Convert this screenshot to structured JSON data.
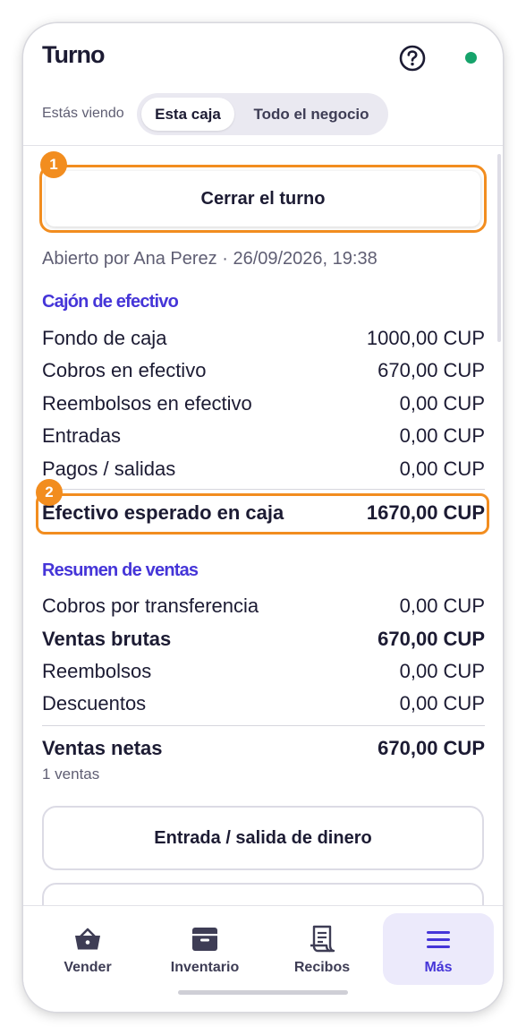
{
  "header": {
    "title": "Turno",
    "help_icon": "question-circle-icon",
    "status_color": "#16a36b"
  },
  "view_toggle": {
    "label": "Estás viendo",
    "options": [
      "Esta caja",
      "Todo el negocio"
    ],
    "selected": "Esta caja"
  },
  "callouts": [
    "1",
    "2"
  ],
  "close_shift_button": "Cerrar el turno",
  "opened_by": "Abierto por Ana Perez · 26/09/2026, 19:38",
  "cash_drawer": {
    "title": "Cajón de efectivo",
    "rows": [
      {
        "label": "Fondo de caja",
        "value": "1000,00 CUP"
      },
      {
        "label": "Cobros en efectivo",
        "value": "670,00 CUP"
      },
      {
        "label": "Reembolsos en efectivo",
        "value": "0,00 CUP"
      },
      {
        "label": "Entradas",
        "value": "0,00 CUP"
      },
      {
        "label": "Pagos / salidas",
        "value": "0,00 CUP"
      }
    ],
    "expected": {
      "label": "Efectivo esperado en caja",
      "value": "1670,00 CUP"
    }
  },
  "sales_summary": {
    "title": "Resumen de ventas",
    "rows": [
      {
        "label": "Cobros por transferencia",
        "value": "0,00 CUP"
      },
      {
        "label": "Ventas brutas",
        "value": "670,00 CUP"
      },
      {
        "label": "Reembolsos",
        "value": "0,00 CUP"
      },
      {
        "label": "Descuentos",
        "value": "0,00 CUP"
      }
    ],
    "net": {
      "label": "Ventas netas",
      "value": "670,00 CUP"
    },
    "count": "1 ventas"
  },
  "cash_in_out_button": "Entrada / salida de dinero",
  "bottom_nav": [
    {
      "label": "Vender",
      "icon": "basket-icon"
    },
    {
      "label": "Inventario",
      "icon": "archive-box-icon"
    },
    {
      "label": "Recibos",
      "icon": "receipt-icon"
    },
    {
      "label": "Más",
      "icon": "menu-icon",
      "active": true
    }
  ],
  "colors": {
    "accent": "#4535d8",
    "callout": "#f28d1f",
    "text": "#1c1b33",
    "secondary_text": "#5f5e73"
  }
}
